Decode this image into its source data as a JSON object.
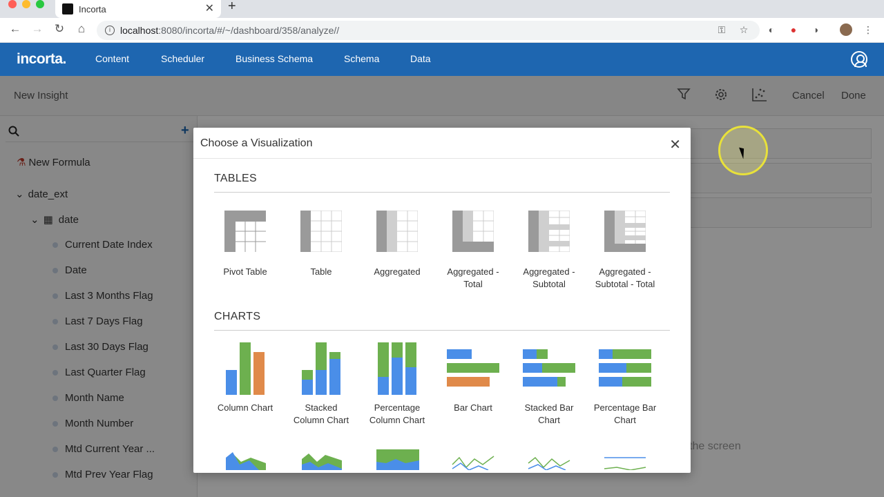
{
  "browser": {
    "tab_title": "Incorta",
    "url_host": "localhost",
    "url_path": ":8080/incorta/#/~/dashboard/358/analyze//"
  },
  "app": {
    "logo": "incorta.",
    "nav": [
      "Content",
      "Scheduler",
      "Business Schema",
      "Schema",
      "Data"
    ]
  },
  "subheader": {
    "title": "New Insight",
    "cancel": "Cancel",
    "done": "Done"
  },
  "sidebar": {
    "new_formula": "New Formula",
    "group": "date_ext",
    "table": "date",
    "fields": [
      "Current Date Index",
      "Date",
      "Last 3 Months Flag",
      "Last 7 Days Flag",
      "Last 30 Days Flag",
      "Last Quarter Flag",
      "Month Name",
      "Month Number",
      "Mtd Current Year ...",
      "Mtd Prev Year Flag"
    ]
  },
  "main": {
    "hint": "the screen"
  },
  "modal": {
    "title": "Choose a Visualization",
    "tables_title": "TABLES",
    "charts_title": "CHARTS",
    "tables": [
      {
        "label1": "Pivot Table",
        "label2": ""
      },
      {
        "label1": "Table",
        "label2": ""
      },
      {
        "label1": "Aggregated",
        "label2": ""
      },
      {
        "label1": "Aggregated -",
        "label2": "Total"
      },
      {
        "label1": "Aggregated -",
        "label2": "Subtotal"
      },
      {
        "label1": "Aggregated -",
        "label2": "Subtotal - Total"
      }
    ],
    "charts": [
      {
        "label1": "Column Chart",
        "label2": ""
      },
      {
        "label1": "Stacked",
        "label2": "Column Chart"
      },
      {
        "label1": "Percentage",
        "label2": "Column Chart"
      },
      {
        "label1": "Bar Chart",
        "label2": ""
      },
      {
        "label1": "Stacked Bar",
        "label2": "Chart"
      },
      {
        "label1": "Percentage Bar",
        "label2": "Chart"
      }
    ]
  },
  "colors": {
    "brand": "#1e66b0",
    "chart_blue": "#4a8ee8",
    "chart_green": "#6db04f",
    "chart_orange": "#e08a4a",
    "table_gray": "#9a9a9a"
  }
}
